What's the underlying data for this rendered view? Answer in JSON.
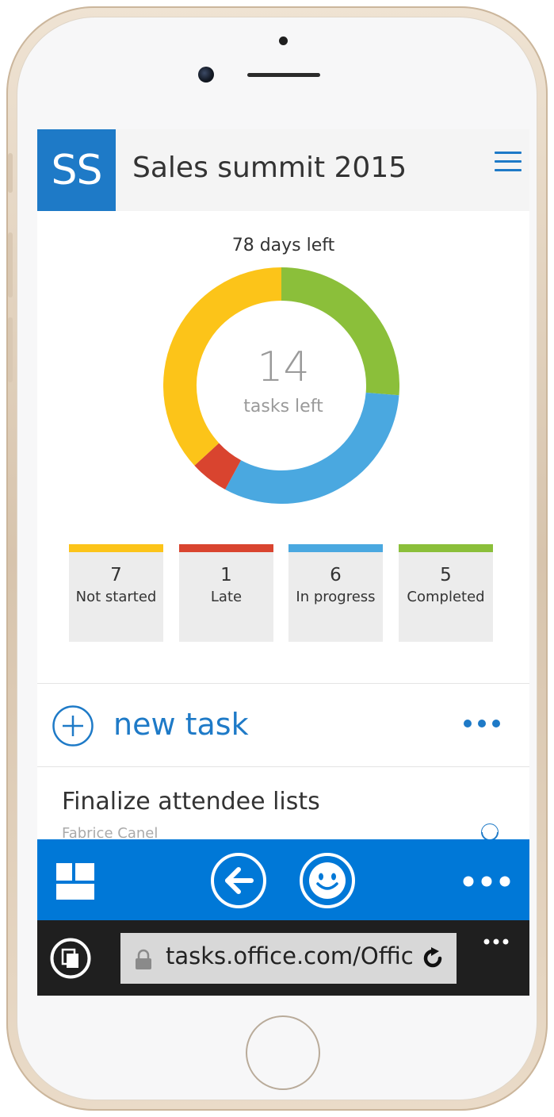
{
  "header": {
    "logo_text": "SS",
    "title": "Sales summit 2015"
  },
  "summary": {
    "days_left_text": "78 days left",
    "tasks_left_count": "14",
    "tasks_left_label": "tasks left"
  },
  "status": [
    {
      "count": "7",
      "label": "Not started",
      "color": "#fcc419"
    },
    {
      "count": "1",
      "label": "Late",
      "color": "#d9442f"
    },
    {
      "count": "6",
      "label": "In progress",
      "color": "#4aa8e0"
    },
    {
      "count": "5",
      "label": "Completed",
      "color": "#8bbf3a"
    }
  ],
  "new_task": {
    "label": "new task"
  },
  "task": {
    "title": "Finalize attendee lists",
    "assignee": "Fabrice Canel"
  },
  "browser": {
    "url": "tasks.office.com/Offic"
  },
  "colors": {
    "accent": "#1e7ac7",
    "app_bar": "#0078d7"
  },
  "icons": [
    "menu-icon",
    "plus-circle-icon",
    "more-icon",
    "grid-icon",
    "back-arrow-icon",
    "smiley-icon",
    "tabs-icon",
    "lock-icon",
    "refresh-icon"
  ]
}
